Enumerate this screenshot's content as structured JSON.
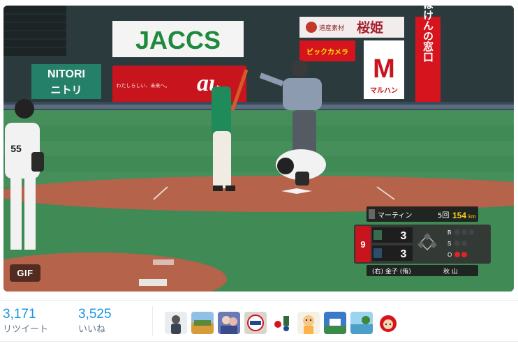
{
  "media": {
    "badge": "GIF",
    "signs": {
      "sponsor_main": "JACCS",
      "sponsor_left_top": "NITORI",
      "sponsor_left_bottom": "ニトリ",
      "sponsor_center_tagline": "わたしらしい、未来へ。",
      "sponsor_center_brand": "au",
      "sponsor_top_right_small": "道産素材",
      "sponsor_top_right": "桜姫",
      "sponsor_camera": "ビックカメラ",
      "sponsor_maruhan_mark": "M",
      "sponsor_maruhan": "マルハン",
      "sponsor_vertical": "ほけんの窓口"
    },
    "player_number": "55",
    "scoreboard": {
      "pitcher_name": "マーティン",
      "inning": "5回",
      "pitch_speed": "154",
      "pitch_unit": "km",
      "inning_marker": "9",
      "team_top_score": "3",
      "team_bottom_score": "3",
      "balls_label": "B",
      "strikes_label": "S",
      "outs_label": "O",
      "batter_line_left": "(右) 金子 (侑)",
      "batter_line_right": "秋 山"
    }
  },
  "stats": {
    "retweets": {
      "count": "3,171",
      "label": "リツイート"
    },
    "likes": {
      "count": "3,525",
      "label": "いいね"
    }
  },
  "avatars": [
    {
      "name": "avatar-user-1"
    },
    {
      "name": "avatar-user-2"
    },
    {
      "name": "avatar-user-3"
    },
    {
      "name": "avatar-user-4"
    },
    {
      "name": "avatar-user-5"
    },
    {
      "name": "avatar-user-6"
    },
    {
      "name": "avatar-user-7"
    },
    {
      "name": "avatar-user-8"
    },
    {
      "name": "avatar-user-9"
    }
  ],
  "colors": {
    "accent": "#1b95e0",
    "muted": "#657786",
    "field_green": "#3f8a55",
    "dirt": "#b5634a"
  }
}
